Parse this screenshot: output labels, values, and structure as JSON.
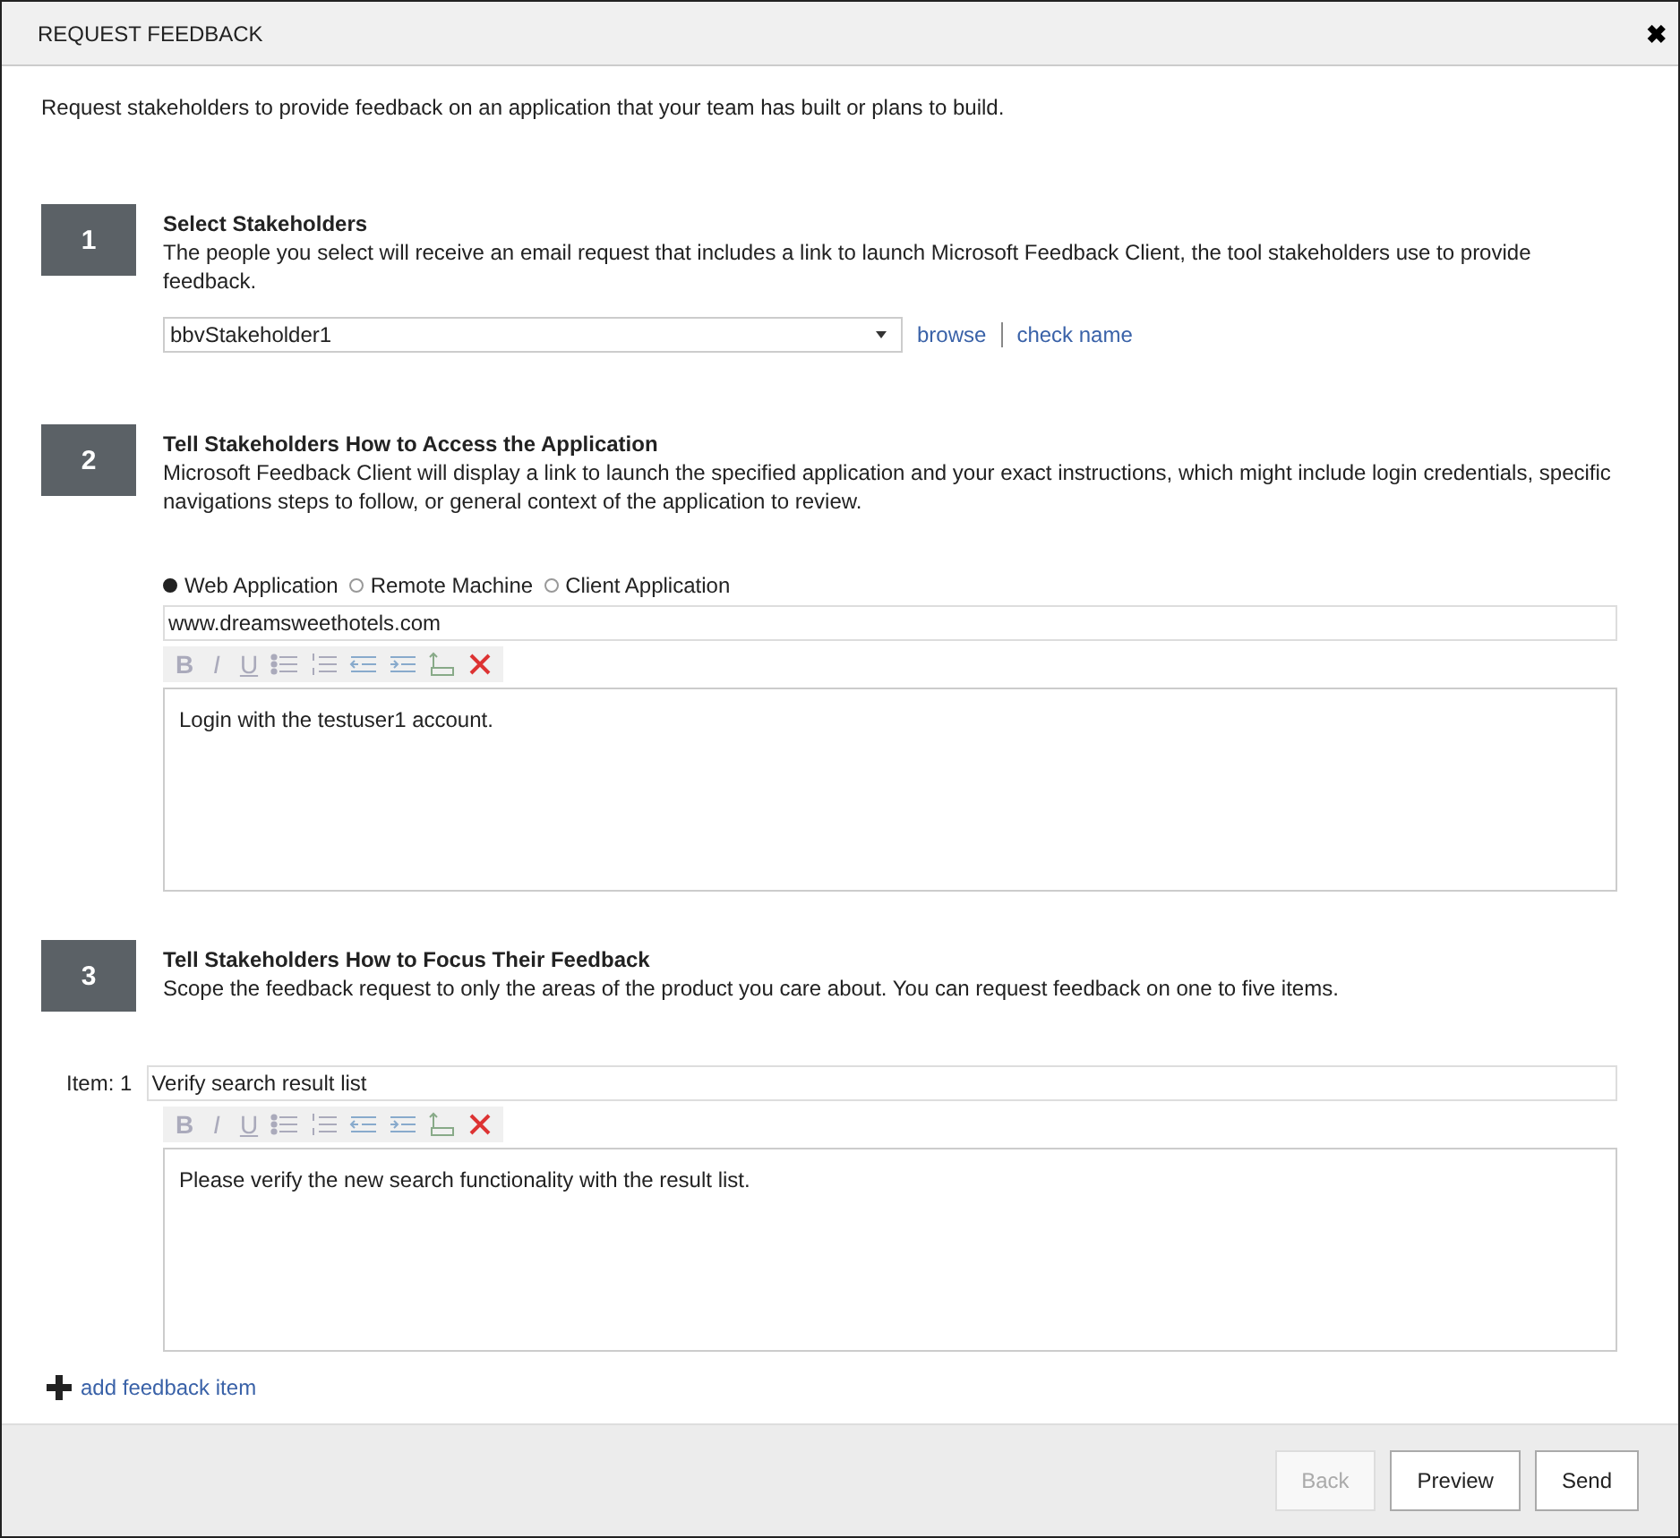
{
  "window": {
    "title": "REQUEST FEEDBACK",
    "close": "✖"
  },
  "intro": "Request stakeholders to provide feedback on an application that your team has built or plans to build.",
  "steps": [
    {
      "number": "1",
      "title": "Select Stakeholders",
      "description": "The people you select will receive an email request that includes a link to launch Microsoft Feedback Client, the tool stakeholders use to provide feedback."
    },
    {
      "number": "2",
      "title": "Tell Stakeholders How to Access the Application",
      "description": "Microsoft Feedback Client will display a link to launch the specified application and your exact instructions, which might include login credentials, specific navigations steps to follow, or general context of the application to review."
    },
    {
      "number": "3",
      "title": "Tell Stakeholders How to Focus Their Feedback",
      "description": "Scope the feedback request to only the areas of the product you care about. You can request feedback on one to five items."
    }
  ],
  "stakeholder": {
    "value": "bbvStakeholder1",
    "links": [
      "browse",
      "check name"
    ]
  },
  "access_types": [
    {
      "label": "Web Application",
      "selected": true
    },
    {
      "label": "Remote Machine",
      "selected": false
    },
    {
      "label": "Client Application",
      "selected": false
    }
  ],
  "url": "www.dreamsweethotels.com",
  "instructions_toolbar": {
    "labels": [
      "B",
      "I",
      "U"
    ]
  },
  "instructions": "Login with the testuser1 account.",
  "item": {
    "label": "Item: 1",
    "title": "Verify search result list",
    "toolbar": {
      "labels": [
        "B",
        "I",
        "U"
      ]
    },
    "details": "Please verify the new search functionality with the result list."
  },
  "add_item": "add feedback item",
  "buttons": [
    {
      "label": "Back",
      "disabled": true
    },
    {
      "label": "Preview",
      "disabled": false
    },
    {
      "label": "Send",
      "disabled": false
    }
  ]
}
